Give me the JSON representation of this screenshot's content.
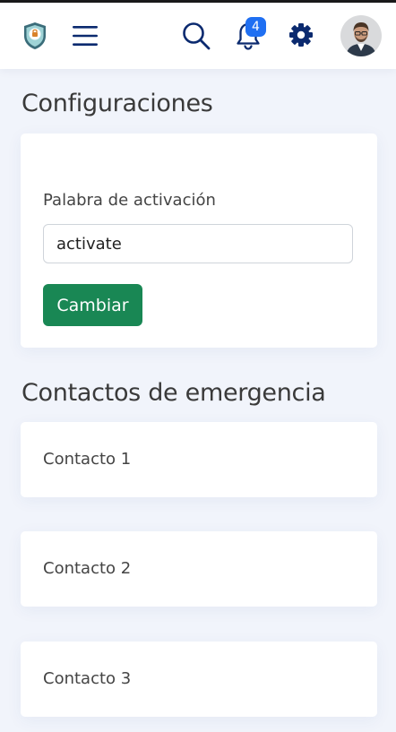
{
  "header": {
    "logo_icon": "shield-logo-icon",
    "menu_icon": "hamburger-menu-icon",
    "search_icon": "search-icon",
    "notifications_icon": "bell-icon",
    "notifications_count": "4",
    "settings_icon": "gear-icon",
    "avatar_icon": "user-avatar"
  },
  "settings": {
    "title": "Configuraciones",
    "activation_label": "Palabra de activación",
    "activation_value": "activate",
    "change_button": "Cambiar"
  },
  "contacts": {
    "title": "Contactos de emergencia",
    "items": [
      {
        "label": "Contacto 1"
      },
      {
        "label": "Contacto 2"
      },
      {
        "label": "Contacto 3"
      }
    ]
  },
  "colors": {
    "primary": "#0b2a6f",
    "badge": "#1f6ff2",
    "button": "#198754",
    "background": "#f1f4fb"
  }
}
